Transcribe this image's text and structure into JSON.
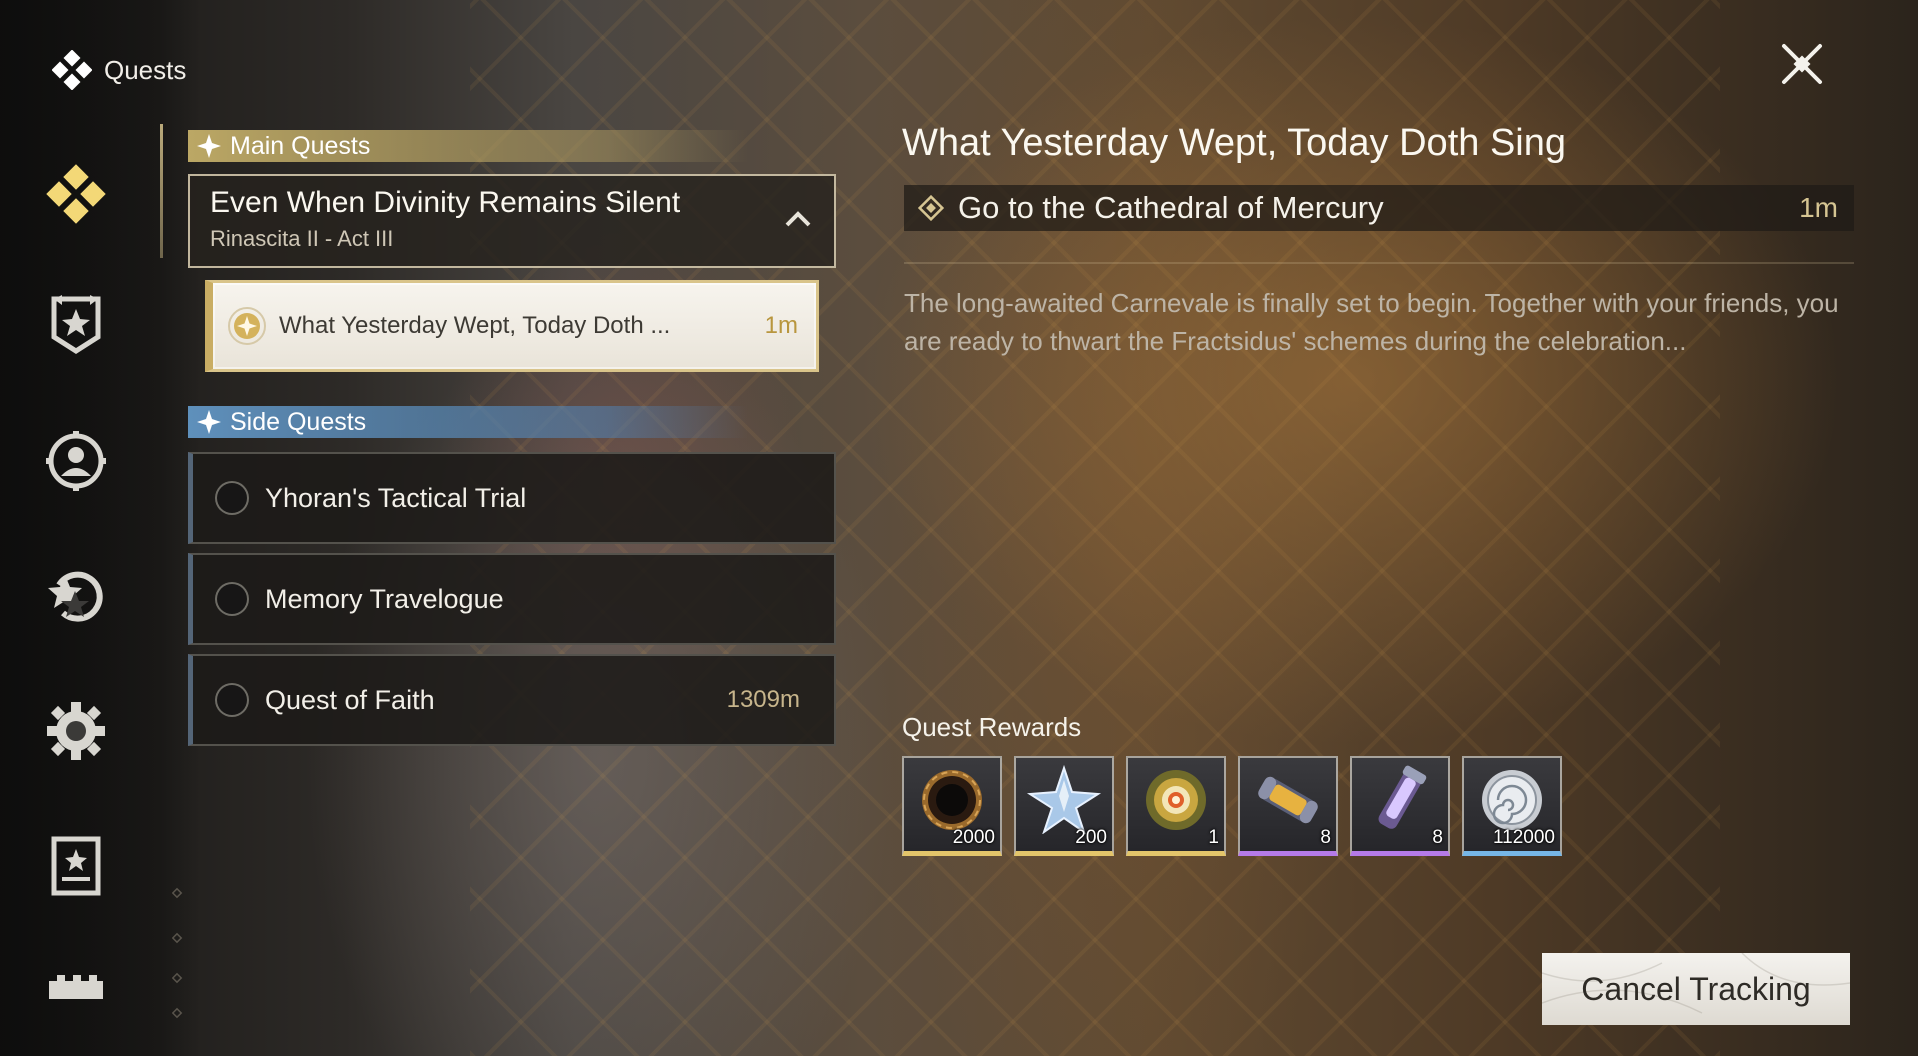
{
  "header": {
    "title": "Quests",
    "icon": "quests-diamond-icon"
  },
  "close_icon": "close-x-icon",
  "sidebar": {
    "items": [
      {
        "id": "quests",
        "icon": "quests-diamond-icon",
        "active": true
      },
      {
        "id": "guild",
        "icon": "shield-star-icon",
        "active": false
      },
      {
        "id": "companion",
        "icon": "companion-avatar-icon",
        "active": false
      },
      {
        "id": "events",
        "icon": "star-refresh-icon",
        "active": false
      },
      {
        "id": "settings",
        "icon": "gear-icon",
        "active": false
      },
      {
        "id": "archive",
        "icon": "card-book-icon",
        "active": false
      },
      {
        "id": "more",
        "icon": "castle-wall-icon",
        "active": false
      }
    ]
  },
  "quest_list": {
    "main_section_label": "Main Quests",
    "chapter": {
      "title": "Even When Divinity Remains Silent",
      "subtitle": "Rinascita II - Act III"
    },
    "tracked_quest": {
      "name": "What Yesterday Wept, Today Doth ...",
      "distance": "1m"
    },
    "side_section_label": "Side Quests",
    "side_quests": [
      {
        "name": "Yhoran's Tactical Trial",
        "distance": ""
      },
      {
        "name": "Memory Travelogue",
        "distance": ""
      },
      {
        "name": "Quest of Faith",
        "distance": "1309m"
      }
    ]
  },
  "detail": {
    "title": "What Yesterday Wept, Today Doth Sing",
    "objective": "Go to the Cathedral of Mercury",
    "objective_distance": "1m",
    "description": "The long-awaited Carnevale is finally set to begin. Together with your friends, you are ready to thwart the Fractsidus' schemes during the celebration...",
    "rewards_label": "Quest Rewards",
    "rewards": [
      {
        "icon": "dark-ring-material-icon",
        "quantity": "2000",
        "rarity": "gold"
      },
      {
        "icon": "crystal-star-icon",
        "quantity": "200",
        "rarity": "gold"
      },
      {
        "icon": "golden-orb-icon",
        "quantity": "1",
        "rarity": "gold"
      },
      {
        "icon": "energy-capsule-icon",
        "quantity": "8",
        "rarity": "purple"
      },
      {
        "icon": "crystal-vial-icon",
        "quantity": "8",
        "rarity": "purple"
      },
      {
        "icon": "shell-coin-icon",
        "quantity": "112000",
        "rarity": "blue"
      }
    ],
    "cancel_button_label": "Cancel Tracking"
  },
  "colors": {
    "main_quest_accent": "#c4af69",
    "side_quest_accent": "#6296c4",
    "active_icon": "#f3d877",
    "distance_gold": "#b8963e"
  }
}
